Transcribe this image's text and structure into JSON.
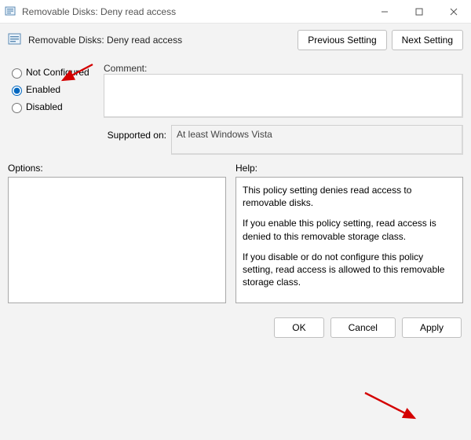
{
  "window": {
    "title": "Removable Disks: Deny read access"
  },
  "header": {
    "policy_title": "Removable Disks: Deny read access",
    "previous": "Previous Setting",
    "next": "Next Setting"
  },
  "radios": {
    "not_configured": "Not Configured",
    "enabled": "Enabled",
    "disabled": "Disabled",
    "selected": "enabled"
  },
  "comment": {
    "label": "Comment:",
    "value": ""
  },
  "supported": {
    "label": "Supported on:",
    "value": "At least Windows Vista"
  },
  "panes": {
    "options_label": "Options:",
    "help_label": "Help:",
    "options_text": "",
    "help_p1": "This policy setting denies read access to removable disks.",
    "help_p2": "If you enable this policy setting, read access is denied to this removable storage class.",
    "help_p3": "If you disable or do not configure this policy setting, read access is allowed to this removable storage class."
  },
  "footer": {
    "ok": "OK",
    "cancel": "Cancel",
    "apply": "Apply"
  }
}
